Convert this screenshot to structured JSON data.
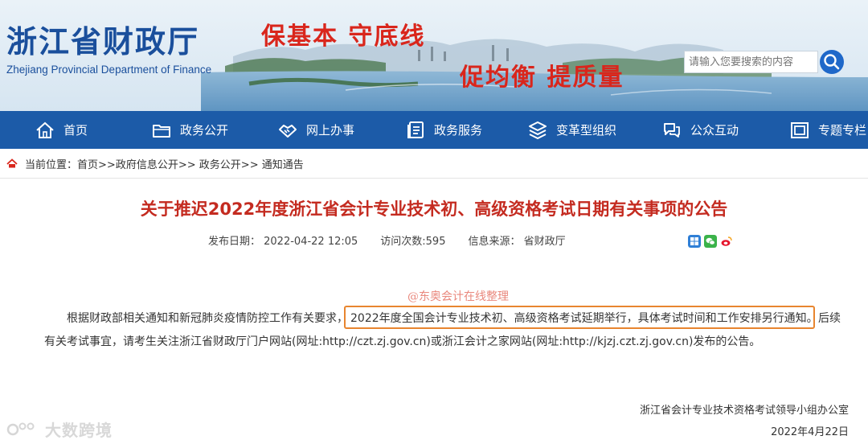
{
  "site": {
    "name_cn": "浙江省财政厅",
    "name_en": "Zhejiang Provincial Department of Finance",
    "slogan_line1": "保基本  守底线",
    "slogan_line2": "促均衡  提质量"
  },
  "search": {
    "placeholder": "请输入您要搜索的内容",
    "button_icon": "magnifier-icon"
  },
  "nav": {
    "items": [
      {
        "label": "首页",
        "icon": "home-icon"
      },
      {
        "label": "政务公开",
        "icon": "folder-icon"
      },
      {
        "label": "网上办事",
        "icon": "handshake-icon"
      },
      {
        "label": "政务服务",
        "icon": "document-icon"
      },
      {
        "label": "变革型组织",
        "icon": "layers-icon"
      },
      {
        "label": "公众互动",
        "icon": "chat-icon"
      },
      {
        "label": "专题专栏",
        "icon": "column-icon"
      }
    ]
  },
  "breadcrumb": {
    "prefix": "当前位置：",
    "items": [
      "首页",
      "政府信息公开",
      "政务公开",
      "通知通告"
    ],
    "separator": ">>"
  },
  "article": {
    "title": "关于推迟2022年度浙江省会计专业技术初、高级资格考试日期有关事项的公告",
    "publish_date": "发布日期：  2022-04-22 12:05",
    "visits": "访问次数:595",
    "source": "信息来源：  省财政厅",
    "watermark": "@东奥会计在线整理",
    "para_line1_start": "根据财政部相关通知和新冠肺炎疫情防控工作有关要求，",
    "para_highlight": "2022年度全国会计专业技术初、高级资格考试延期举行，具体考试时间和工作安排另行通知。",
    "para_line1_tail": "后续",
    "para_line2": "有关考试事宜，请考生关注浙江省财政厅门户网站(网址:http://czt.zj.gov.cn)或浙江会计之家网站(网址:http://kjzj.czt.zj.gov.cn)发布的公告。",
    "signature_org": "浙江省会计专业技术资格考试领导小组办公室",
    "signature_date": "2022年4月22日"
  },
  "share": [
    "share-plus-icon",
    "wechat-icon",
    "weibo-icon"
  ],
  "corner_watermark": "大数跨境",
  "colors": {
    "nav_bg": "#1c5ba8",
    "title": "#c42b20",
    "slogan": "#d9261c",
    "logo": "#1a4f9c",
    "highlight_border": "#e8852f"
  }
}
